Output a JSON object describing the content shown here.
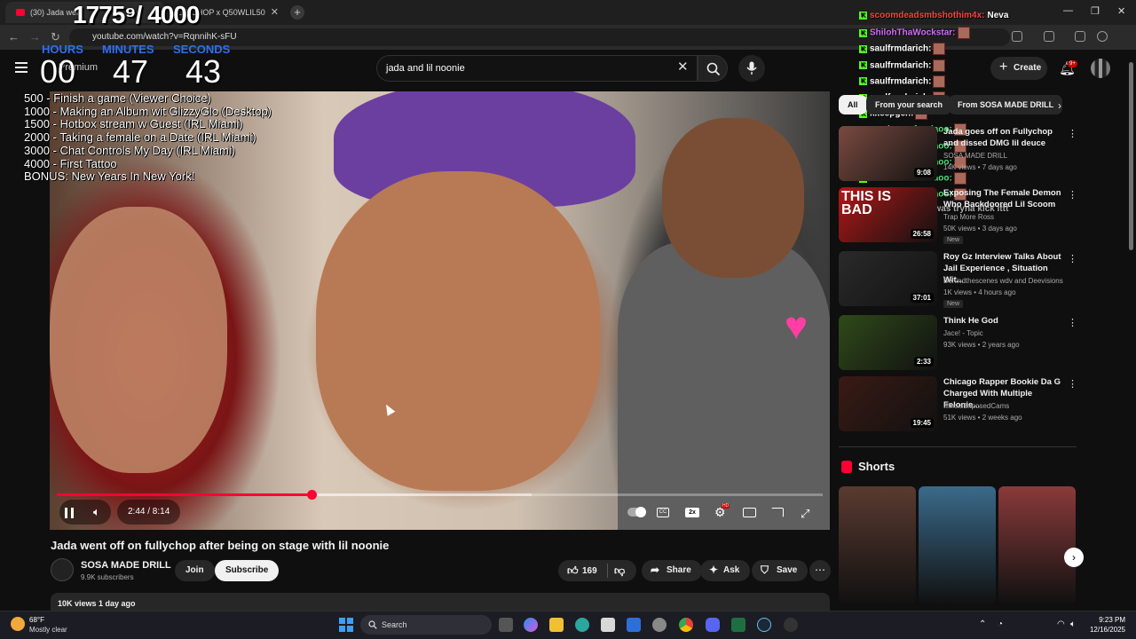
{
  "browser": {
    "tab_active_title": "(30) Jada went",
    "tab2_title": "LLYCHOP x Q50WLIL50",
    "url": "youtube.com/watch?v=RqnnihK-sFU",
    "new_tab": "+",
    "win_min": "—",
    "win_max": "❐",
    "win_close": "✕"
  },
  "header": {
    "brand": "Premium",
    "search_value": "jada and lil noonie",
    "clear": "✕",
    "create_label": "Create",
    "notifications_badge": "9+"
  },
  "overlay": {
    "counter": "1775⁹/ 4000",
    "hours_label": "HOURS",
    "minutes_label": "MINUTES",
    "seconds_label": "SECONDS",
    "hours": "00",
    "minutes": "47",
    "seconds": "43",
    "goals": [
      " 500 - Finish a game (Viewer Choice)",
      "1000 - Making an Album wit GlizzyGlo (Desktop)",
      "1500 - Hotbox stream w Guest (IRL Miami)",
      "2000 - Taking a female on a Date (IRL Miami)",
      "3000 - Chat Controls My Day (IRL Miami)",
      "4000 - First Tattoo",
      "BONUS: New Years In New York!"
    ]
  },
  "chat": [
    {
      "user": "scoomdeadsmbshothim4x:",
      "msg": "Neva",
      "color": "#ff4040"
    },
    {
      "user": "ShilohThaWockstar:",
      "msg": "",
      "color": "#d36bff"
    },
    {
      "user": "saulfrmdarich:",
      "msg": "",
      "color": "#ffffff"
    },
    {
      "user": "saulfrmdarich:",
      "msg": "",
      "color": "#ffffff"
    },
    {
      "user": "saulfrmdarich:",
      "msg": "",
      "color": "#ffffff"
    },
    {
      "user": "saulfrmdarich:",
      "msg": "",
      "color": "#ffffff"
    },
    {
      "user": "kkeepgen:",
      "msg": "",
      "color": "#ffffff"
    },
    {
      "user": "cambammfrmdaoo:",
      "msg": "",
      "color": "#50e07a"
    },
    {
      "user": "cambammfrmdaoo:",
      "msg": "",
      "color": "#50e07a"
    },
    {
      "user": "cambammfrmdaoo:",
      "msg": "",
      "color": "#50e07a"
    },
    {
      "user": "cambammfrmdaoo:",
      "msg": "",
      "color": "#50e07a"
    },
    {
      "user": "cambammfrmdaoo:",
      "msg": "",
      "color": "#50e07a"
    },
    {
      "user": "shiloh96x:",
      "msg": "she was tryna kick ittt",
      "color": "#888888"
    }
  ],
  "player": {
    "time": "2:44 / 8:14",
    "progress": 0.333,
    "buffered": 0.62,
    "speed": "2x",
    "cc": "CC",
    "hd_badge": "HD"
  },
  "video": {
    "title": "Jada went off on fullychop after being on stage with lil noonie",
    "channel": "SOSA MADE DRILL",
    "subscribers": "9.9K subscribers",
    "join": "Join",
    "subscribe": "Subscribe",
    "likes": "169",
    "share": "Share",
    "ask": "Ask",
    "save": "Save",
    "views_date": "10K views  1 day ago"
  },
  "sidebar": {
    "chips": [
      "All",
      "From your search",
      "From SOSA MADE DRILL"
    ],
    "recs": [
      {
        "title": "Jada goes off on Fullychop and dissed DMG lil deuce",
        "channel": "SOSA MADE DRILL",
        "meta": "14K views • 7 days ago",
        "duration": "9:08",
        "new": "",
        "thumb": "#7a4a40"
      },
      {
        "title": "Exposing The Female Demon Who Backdoored Lil Scoom",
        "channel": "Trap More Ross",
        "meta": "50K views • 3 days ago",
        "duration": "26:58",
        "new": "New",
        "thumb": "#b01818",
        "thumb_text": "THIS IS BAD"
      },
      {
        "title": "Roy Gz Interview Talks About Jail Experience , Situation Wit...",
        "channel": "Behindthescenes wdv and Deevisions",
        "meta": "1K views • 4 hours ago",
        "duration": "37:01",
        "new": "New",
        "thumb": "#2a2a2a"
      },
      {
        "title": "Think He God",
        "channel": "Jace! - Topic",
        "meta": "93K views • 2 years ago",
        "duration": "2:33",
        "new": "",
        "thumb": "#2f4a1a"
      },
      {
        "title": "Chicago Rapper Bookie Da G Charged With Multiple Felonie...",
        "channel": "IllinoisExposedCams",
        "meta": "51K views • 2 weeks ago",
        "duration": "19:45",
        "new": "",
        "thumb": "#3a1a14"
      }
    ],
    "shorts_title": "Shorts",
    "shorts": [
      "#5a3a30",
      "#3a6a8a",
      "#8a3a3a"
    ],
    "next": "›"
  },
  "taskbar": {
    "temp": "68°F",
    "condition": "Mostly clear",
    "search": "Search",
    "time": "9:23 PM",
    "date": "12/16/2025"
  }
}
